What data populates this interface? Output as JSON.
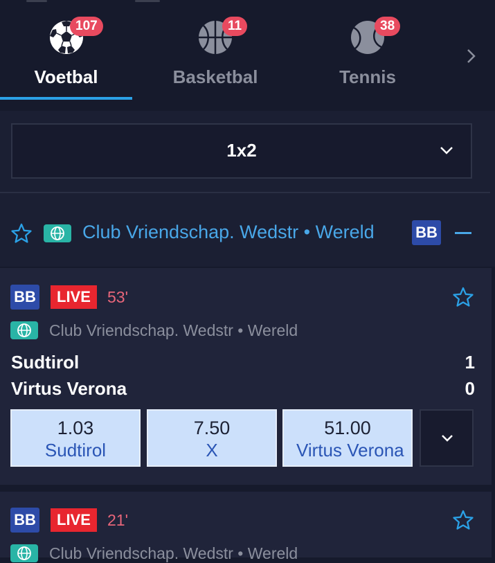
{
  "sports_tabs": [
    {
      "label": "Voetbal",
      "count": "107",
      "icon": "soccer-ball-icon",
      "active": true
    },
    {
      "label": "Basketbal",
      "count": "11",
      "icon": "basketball-icon",
      "active": false
    },
    {
      "label": "Tennis",
      "count": "38",
      "icon": "tennis-ball-icon",
      "active": false
    }
  ],
  "market_select": {
    "value": "1x2"
  },
  "league_header": {
    "title": "Club Vriendschap. Wedstr • Wereld",
    "badge": "BB"
  },
  "matches": [
    {
      "badge": "BB",
      "live_label": "LIVE",
      "minute": "53'",
      "league": "Club Vriendschap. Wedstr • Wereld",
      "home_team": "Sudtirol",
      "away_team": "Virtus Verona",
      "home_score": "1",
      "away_score": "0",
      "odds": [
        {
          "odd": "1.03",
          "name": "Sudtirol"
        },
        {
          "odd": "7.50",
          "name": "X"
        },
        {
          "odd": "51.00",
          "name": "Virtus Verona"
        }
      ]
    },
    {
      "badge": "BB",
      "live_label": "LIVE",
      "minute": "21'",
      "league": "Club Vriendschap. Wedstr • Wereld"
    }
  ],
  "colors": {
    "accent": "#2ba1e6",
    "count_badge": "#e84a5f",
    "live": "#e8262f",
    "league_link": "#49a7e8",
    "odds_bg": "#cce0fb",
    "bb_badge": "#2d4ba8",
    "globe_badge": "#29b4a6"
  }
}
